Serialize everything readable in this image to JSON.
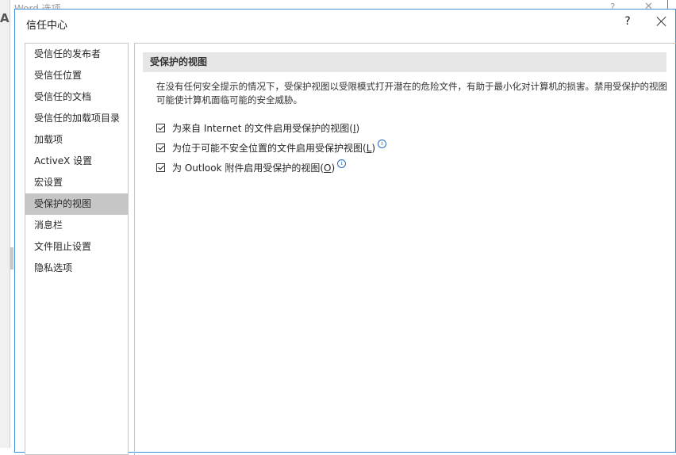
{
  "background": {
    "title": "Word 选项",
    "help_label": "?",
    "close_label": "✕",
    "edge_letter": "A"
  },
  "dialog": {
    "title": "信任中心",
    "help_label": "?"
  },
  "nav": {
    "items": [
      {
        "label": "受信任的发布者",
        "selected": false
      },
      {
        "label": "受信任位置",
        "selected": false
      },
      {
        "label": "受信任的文档",
        "selected": false
      },
      {
        "label": "受信任的加载项目录",
        "selected": false
      },
      {
        "label": "加载项",
        "selected": false
      },
      {
        "label": "ActiveX 设置",
        "selected": false
      },
      {
        "label": "宏设置",
        "selected": false
      },
      {
        "label": "受保护的视图",
        "selected": true
      },
      {
        "label": "消息栏",
        "selected": false
      },
      {
        "label": "文件阻止设置",
        "selected": false
      },
      {
        "label": "隐私选项",
        "selected": false
      }
    ]
  },
  "content": {
    "section_title": "受保护的视图",
    "description": "在没有任何安全提示的情况下，受保护视图以受限模式打开潜在的危险文件，有助于最小化对计算机的损害。禁用受保护的视图可能使计算机面临可能的安全威胁。",
    "options": [
      {
        "label_prefix": "为来自 Internet 的文件启用受保护的视图(",
        "accel": "I",
        "label_suffix": ")",
        "checked": true,
        "info": false
      },
      {
        "label_prefix": "为位于可能不安全位置的文件启用受保护视图(",
        "accel": "L",
        "label_suffix": ")",
        "checked": true,
        "info": true
      },
      {
        "label_prefix": "为 Outlook 附件启用受保护的视图(",
        "accel": "O",
        "label_suffix": ")",
        "checked": true,
        "info": true
      }
    ],
    "info_glyph": "i"
  }
}
